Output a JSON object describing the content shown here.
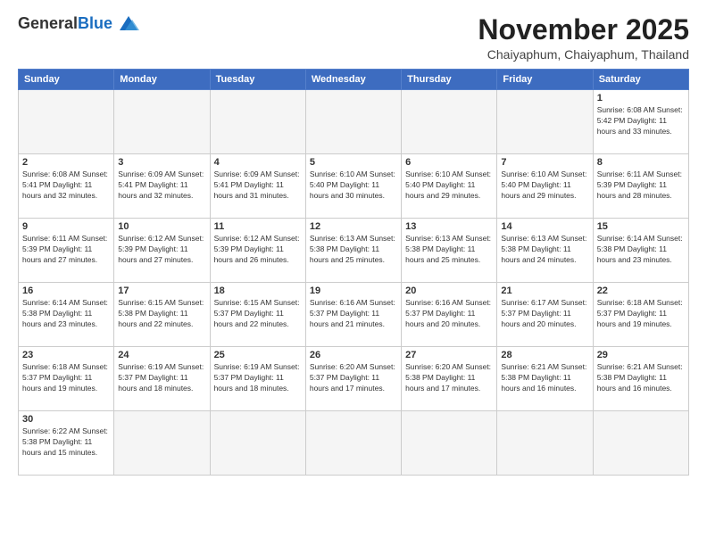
{
  "logo": {
    "general": "General",
    "blue": "Blue"
  },
  "header": {
    "month": "November 2025",
    "location": "Chaiyaphum, Chaiyaphum, Thailand"
  },
  "weekdays": [
    "Sunday",
    "Monday",
    "Tuesday",
    "Wednesday",
    "Thursday",
    "Friday",
    "Saturday"
  ],
  "weeks": [
    [
      {
        "day": "",
        "info": ""
      },
      {
        "day": "",
        "info": ""
      },
      {
        "day": "",
        "info": ""
      },
      {
        "day": "",
        "info": ""
      },
      {
        "day": "",
        "info": ""
      },
      {
        "day": "",
        "info": ""
      },
      {
        "day": "1",
        "info": "Sunrise: 6:08 AM\nSunset: 5:42 PM\nDaylight: 11 hours\nand 33 minutes."
      }
    ],
    [
      {
        "day": "2",
        "info": "Sunrise: 6:08 AM\nSunset: 5:41 PM\nDaylight: 11 hours\nand 32 minutes."
      },
      {
        "day": "3",
        "info": "Sunrise: 6:09 AM\nSunset: 5:41 PM\nDaylight: 11 hours\nand 32 minutes."
      },
      {
        "day": "4",
        "info": "Sunrise: 6:09 AM\nSunset: 5:41 PM\nDaylight: 11 hours\nand 31 minutes."
      },
      {
        "day": "5",
        "info": "Sunrise: 6:10 AM\nSunset: 5:40 PM\nDaylight: 11 hours\nand 30 minutes."
      },
      {
        "day": "6",
        "info": "Sunrise: 6:10 AM\nSunset: 5:40 PM\nDaylight: 11 hours\nand 29 minutes."
      },
      {
        "day": "7",
        "info": "Sunrise: 6:10 AM\nSunset: 5:40 PM\nDaylight: 11 hours\nand 29 minutes."
      },
      {
        "day": "8",
        "info": "Sunrise: 6:11 AM\nSunset: 5:39 PM\nDaylight: 11 hours\nand 28 minutes."
      }
    ],
    [
      {
        "day": "9",
        "info": "Sunrise: 6:11 AM\nSunset: 5:39 PM\nDaylight: 11 hours\nand 27 minutes."
      },
      {
        "day": "10",
        "info": "Sunrise: 6:12 AM\nSunset: 5:39 PM\nDaylight: 11 hours\nand 27 minutes."
      },
      {
        "day": "11",
        "info": "Sunrise: 6:12 AM\nSunset: 5:39 PM\nDaylight: 11 hours\nand 26 minutes."
      },
      {
        "day": "12",
        "info": "Sunrise: 6:13 AM\nSunset: 5:38 PM\nDaylight: 11 hours\nand 25 minutes."
      },
      {
        "day": "13",
        "info": "Sunrise: 6:13 AM\nSunset: 5:38 PM\nDaylight: 11 hours\nand 25 minutes."
      },
      {
        "day": "14",
        "info": "Sunrise: 6:13 AM\nSunset: 5:38 PM\nDaylight: 11 hours\nand 24 minutes."
      },
      {
        "day": "15",
        "info": "Sunrise: 6:14 AM\nSunset: 5:38 PM\nDaylight: 11 hours\nand 23 minutes."
      }
    ],
    [
      {
        "day": "16",
        "info": "Sunrise: 6:14 AM\nSunset: 5:38 PM\nDaylight: 11 hours\nand 23 minutes."
      },
      {
        "day": "17",
        "info": "Sunrise: 6:15 AM\nSunset: 5:38 PM\nDaylight: 11 hours\nand 22 minutes."
      },
      {
        "day": "18",
        "info": "Sunrise: 6:15 AM\nSunset: 5:37 PM\nDaylight: 11 hours\nand 22 minutes."
      },
      {
        "day": "19",
        "info": "Sunrise: 6:16 AM\nSunset: 5:37 PM\nDaylight: 11 hours\nand 21 minutes."
      },
      {
        "day": "20",
        "info": "Sunrise: 6:16 AM\nSunset: 5:37 PM\nDaylight: 11 hours\nand 20 minutes."
      },
      {
        "day": "21",
        "info": "Sunrise: 6:17 AM\nSunset: 5:37 PM\nDaylight: 11 hours\nand 20 minutes."
      },
      {
        "day": "22",
        "info": "Sunrise: 6:18 AM\nSunset: 5:37 PM\nDaylight: 11 hours\nand 19 minutes."
      }
    ],
    [
      {
        "day": "23",
        "info": "Sunrise: 6:18 AM\nSunset: 5:37 PM\nDaylight: 11 hours\nand 19 minutes."
      },
      {
        "day": "24",
        "info": "Sunrise: 6:19 AM\nSunset: 5:37 PM\nDaylight: 11 hours\nand 18 minutes."
      },
      {
        "day": "25",
        "info": "Sunrise: 6:19 AM\nSunset: 5:37 PM\nDaylight: 11 hours\nand 18 minutes."
      },
      {
        "day": "26",
        "info": "Sunrise: 6:20 AM\nSunset: 5:37 PM\nDaylight: 11 hours\nand 17 minutes."
      },
      {
        "day": "27",
        "info": "Sunrise: 6:20 AM\nSunset: 5:38 PM\nDaylight: 11 hours\nand 17 minutes."
      },
      {
        "day": "28",
        "info": "Sunrise: 6:21 AM\nSunset: 5:38 PM\nDaylight: 11 hours\nand 16 minutes."
      },
      {
        "day": "29",
        "info": "Sunrise: 6:21 AM\nSunset: 5:38 PM\nDaylight: 11 hours\nand 16 minutes."
      }
    ],
    [
      {
        "day": "30",
        "info": "Sunrise: 6:22 AM\nSunset: 5:38 PM\nDaylight: 11 hours\nand 15 minutes."
      },
      {
        "day": "",
        "info": ""
      },
      {
        "day": "",
        "info": ""
      },
      {
        "day": "",
        "info": ""
      },
      {
        "day": "",
        "info": ""
      },
      {
        "day": "",
        "info": ""
      },
      {
        "day": "",
        "info": ""
      }
    ]
  ]
}
